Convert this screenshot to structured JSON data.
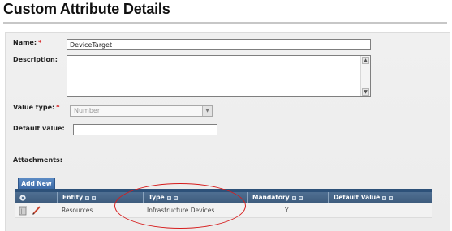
{
  "page": {
    "title": "Custom Attribute Details"
  },
  "form": {
    "name": {
      "label": "Name:",
      "required_mark": "*",
      "value": "DeviceTarget"
    },
    "description": {
      "label": "Description:",
      "value": ""
    },
    "value_type": {
      "label": "Value type:",
      "required_mark": "*",
      "value": "Number"
    },
    "default_value": {
      "label": "Default value:",
      "value": ""
    }
  },
  "attachments": {
    "label": "Attachments:",
    "add_button": "Add New",
    "columns": [
      "Entity",
      "Type",
      "Mandatory",
      "Default Value"
    ],
    "rows": [
      {
        "entity": "Resources",
        "type": "Infrastructure Devices",
        "mandatory": "Y",
        "default_value": ""
      }
    ]
  },
  "colors": {
    "required": "#d40000",
    "grid_header": "#3d5b7c",
    "annotation": "#d61c1c"
  },
  "icons": [
    "grid-settings-icon",
    "delete-icon",
    "edit-icon"
  ]
}
